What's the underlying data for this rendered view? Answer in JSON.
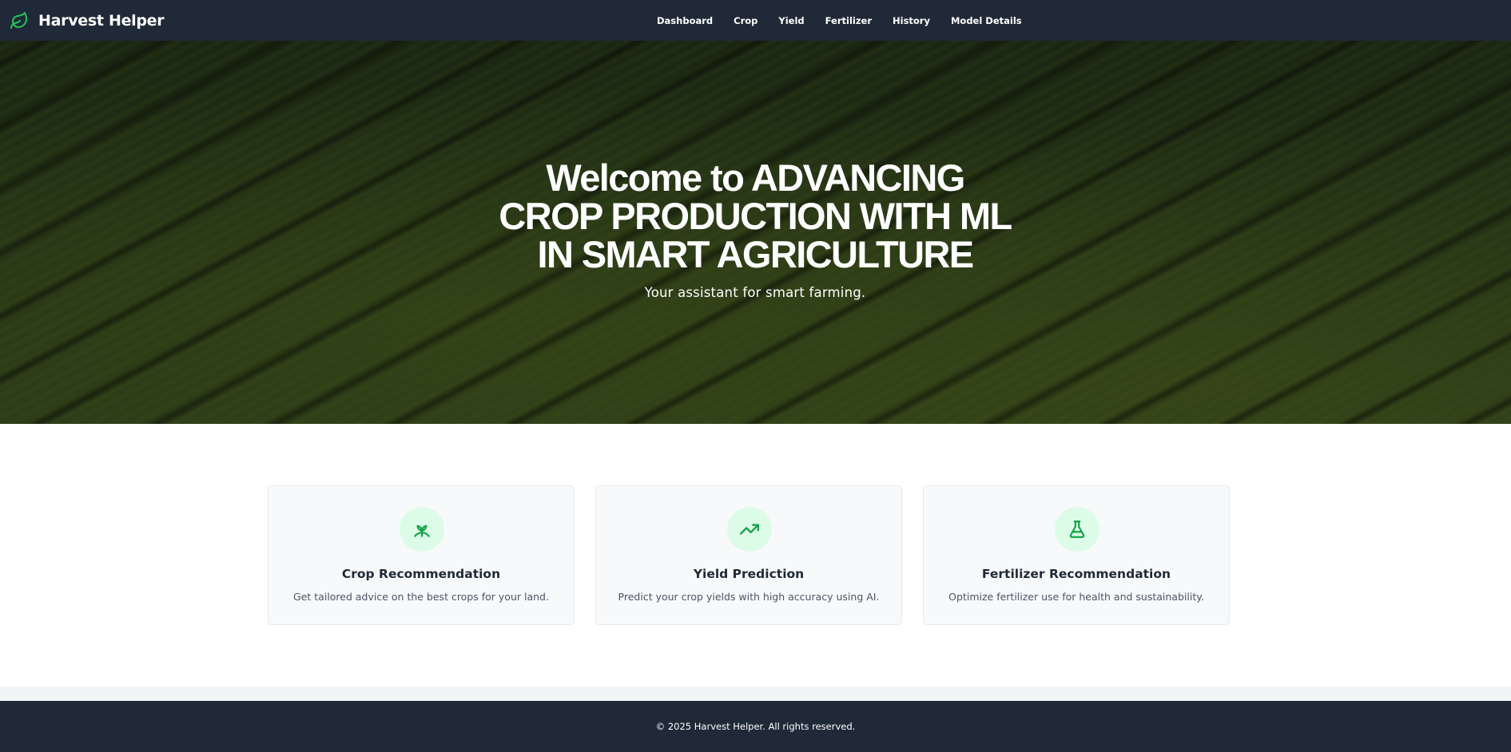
{
  "brand": {
    "name": "Harvest Helper",
    "icon": "leaf-icon",
    "icon_color": "#22c55e"
  },
  "nav": {
    "items": [
      {
        "label": "Dashboard"
      },
      {
        "label": "Crop"
      },
      {
        "label": "Yield"
      },
      {
        "label": "Fertilizer"
      },
      {
        "label": "History"
      },
      {
        "label": "Model Details"
      }
    ]
  },
  "hero": {
    "title_lines": [
      "Welcome to ADVANCING",
      "CROP PRODUCTION WITH ML",
      "IN SMART AGRICULTURE"
    ],
    "subtitle": "Your assistant for smart farming."
  },
  "features": [
    {
      "icon": "sprout-icon",
      "title": "Crop Recommendation",
      "description": "Get tailored advice on the best crops for your land."
    },
    {
      "icon": "trending-up-icon",
      "title": "Yield Prediction",
      "description": "Predict your crop yields with high accuracy using AI."
    },
    {
      "icon": "flask-icon",
      "title": "Fertilizer Recommendation",
      "description": "Optimize fertilizer use for health and sustainability."
    }
  ],
  "footer": {
    "text": "© 2025 Harvest Helper. All rights reserved."
  },
  "colors": {
    "navbar": "#1f2937",
    "accent": "#16a34a",
    "icon_bg": "#dcfce7"
  }
}
